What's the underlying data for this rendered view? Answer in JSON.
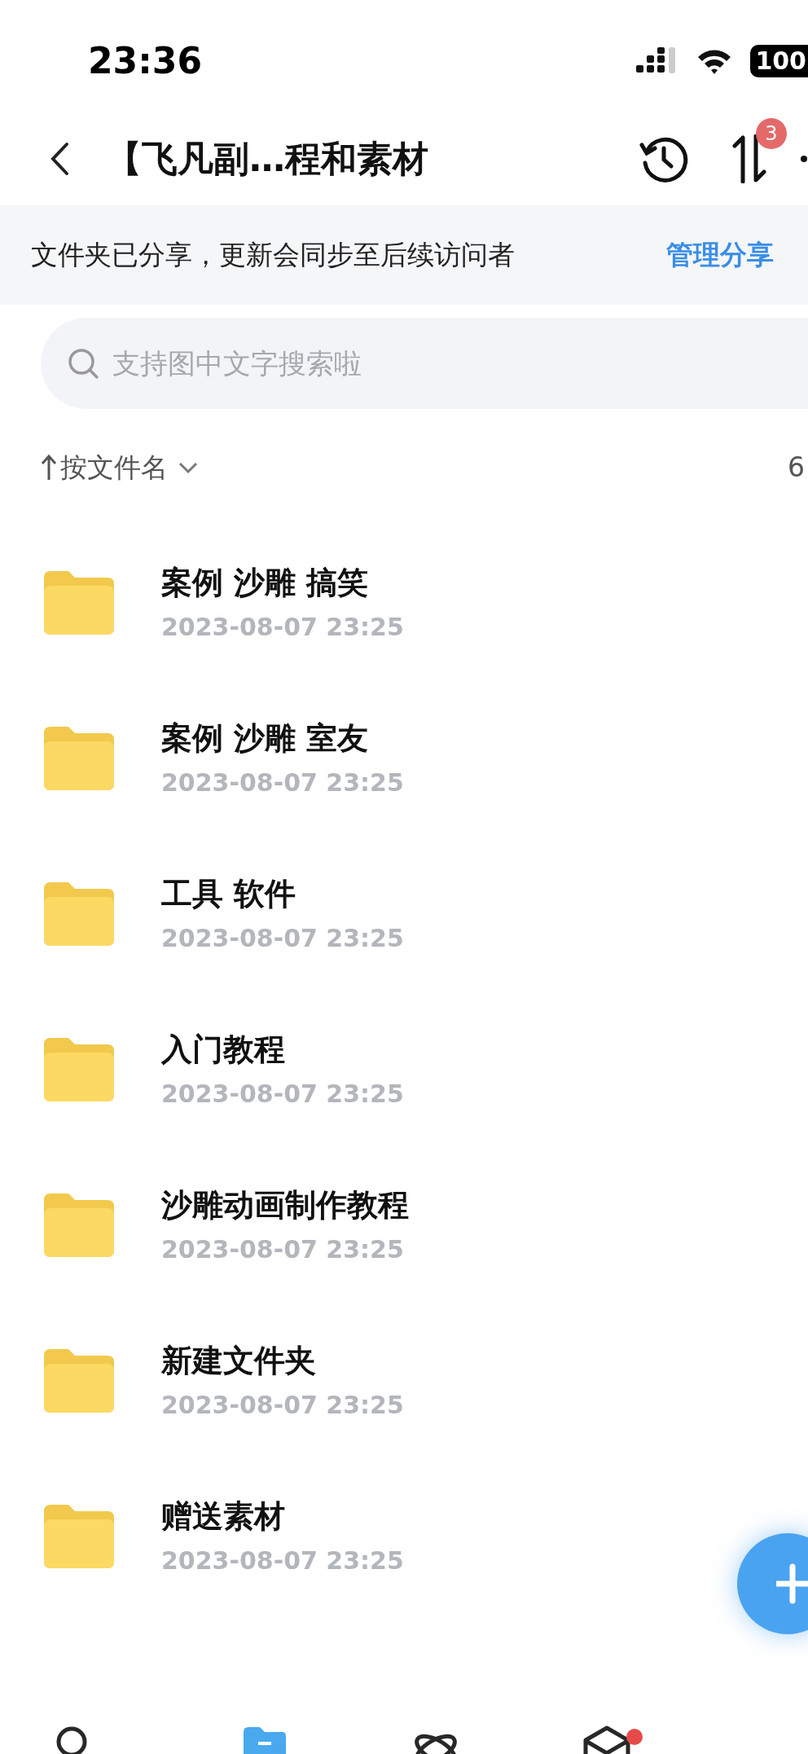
{
  "status_bar": {
    "time": "23:36",
    "battery": "100"
  },
  "header": {
    "title": "【飞凡副…程和素材",
    "badge": "3"
  },
  "share_banner": {
    "text": "文件夹已分享，更新会同步至后续访问者",
    "action": "管理分享"
  },
  "search": {
    "placeholder": "支持图中文字搜索啦"
  },
  "sort": {
    "label": "按文件名",
    "count": "6"
  },
  "folders": [
    {
      "name": "案例 沙雕 搞笑",
      "date": "2023-08-07 23:25"
    },
    {
      "name": "案例 沙雕 室友",
      "date": "2023-08-07 23:25"
    },
    {
      "name": "工具 软件",
      "date": "2023-08-07 23:25"
    },
    {
      "name": "入门教程",
      "date": "2023-08-07 23:25"
    },
    {
      "name": "沙雕动画制作教程",
      "date": "2023-08-07 23:25"
    },
    {
      "name": "新建文件夹",
      "date": "2023-08-07 23:25"
    },
    {
      "name": "赠送素材",
      "date": "2023-08-07 23:25"
    }
  ],
  "tabs": [
    {
      "kind": "person",
      "selected": false,
      "badge": false
    },
    {
      "kind": "folder",
      "selected": true,
      "badge": false
    },
    {
      "kind": "atom",
      "selected": false,
      "badge": false
    },
    {
      "kind": "box",
      "selected": false,
      "badge": true
    }
  ]
}
